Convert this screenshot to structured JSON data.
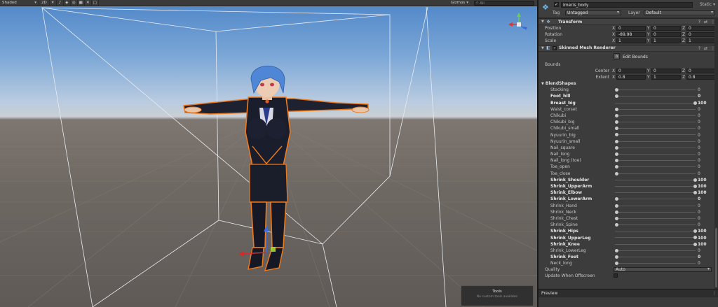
{
  "scene": {
    "toolbar": {
      "shading_mode": "Shaded",
      "mode_2d": "2D",
      "gizmos_label": "Gizmos",
      "search_placeholder": "All"
    },
    "tools_overlay": {
      "title": "Tools",
      "subtitle": "No custom tools available"
    }
  },
  "inspector": {
    "object_name": "Imeris_body",
    "static_label": "Static",
    "tag_label": "Tag",
    "tag_value": "Untagged",
    "layer_label": "Layer",
    "layer_value": "Default",
    "transform": {
      "title": "Transform",
      "rows": [
        {
          "label": "Position",
          "x": "0",
          "y": "0",
          "z": "0"
        },
        {
          "label": "Rotation",
          "x": "-89.98",
          "y": "0",
          "z": "0"
        },
        {
          "label": "Scale",
          "x": "1",
          "y": "1",
          "z": "1"
        }
      ]
    },
    "smr": {
      "title": "Skinned Mesh Renderer",
      "edit_bounds": "Edit Bounds",
      "bounds_label": "Bounds",
      "center": {
        "label": "Center",
        "x": "0",
        "y": "0",
        "z": "0"
      },
      "extent": {
        "label": "Extent",
        "x": "0.8",
        "y": "1",
        "z": "0.8"
      }
    },
    "blendshapes": {
      "title": "BlendShapes",
      "items": [
        {
          "name": "Stocking",
          "value": "0",
          "bold": false
        },
        {
          "name": "Foot_hill",
          "value": "0",
          "bold": true
        },
        {
          "name": "Breast_big",
          "value": "100",
          "bold": true
        },
        {
          "name": "Waist_corset",
          "value": "0",
          "bold": false
        },
        {
          "name": "Chikubi",
          "value": "0",
          "bold": false
        },
        {
          "name": "Chikubi_big",
          "value": "0",
          "bold": false
        },
        {
          "name": "Chikubi_small",
          "value": "0",
          "bold": false
        },
        {
          "name": "Nyuurin_big",
          "value": "0",
          "bold": false
        },
        {
          "name": "Nyuurin_small",
          "value": "0",
          "bold": false
        },
        {
          "name": "Nail_square",
          "value": "0",
          "bold": false
        },
        {
          "name": "Nail_long",
          "value": "0",
          "bold": false
        },
        {
          "name": "Nail_long (toe)",
          "value": "0",
          "bold": false
        },
        {
          "name": "Toe_open",
          "value": "0",
          "bold": false
        },
        {
          "name": "Toe_close",
          "value": "0",
          "bold": false
        },
        {
          "name": "Shrink_Shoulder",
          "value": "100",
          "bold": true
        },
        {
          "name": "Shrink_UpperArm",
          "value": "100",
          "bold": true
        },
        {
          "name": "Shrink_Elbow",
          "value": "100",
          "bold": true
        },
        {
          "name": "Shrink_LowerArm",
          "value": "0",
          "bold": true
        },
        {
          "name": "Shrink_Hand",
          "value": "0",
          "bold": false
        },
        {
          "name": "Shrink_Neck",
          "value": "0",
          "bold": false
        },
        {
          "name": "Shrink_Chest",
          "value": "0",
          "bold": false
        },
        {
          "name": "Shrink_Spine",
          "value": "0",
          "bold": false
        },
        {
          "name": "Shrink_Hips",
          "value": "100",
          "bold": true
        },
        {
          "name": "Shrink_UpperLeg",
          "value": "100",
          "bold": true
        },
        {
          "name": "Shrink_Knee",
          "value": "100",
          "bold": true
        },
        {
          "name": "Shrink_LowerLeg",
          "value": "0",
          "bold": false
        },
        {
          "name": "Shrink_Foot",
          "value": "0",
          "bold": true
        },
        {
          "name": "Neck_long",
          "value": "0",
          "bold": false
        }
      ]
    },
    "quality_label": "Quality",
    "quality_value": "Auto",
    "update_offscreen_label": "Update When Offscreen",
    "preview_label": "Preview"
  },
  "colors": {
    "outline": "#f07a1a",
    "accent": "#6fb3e6"
  }
}
